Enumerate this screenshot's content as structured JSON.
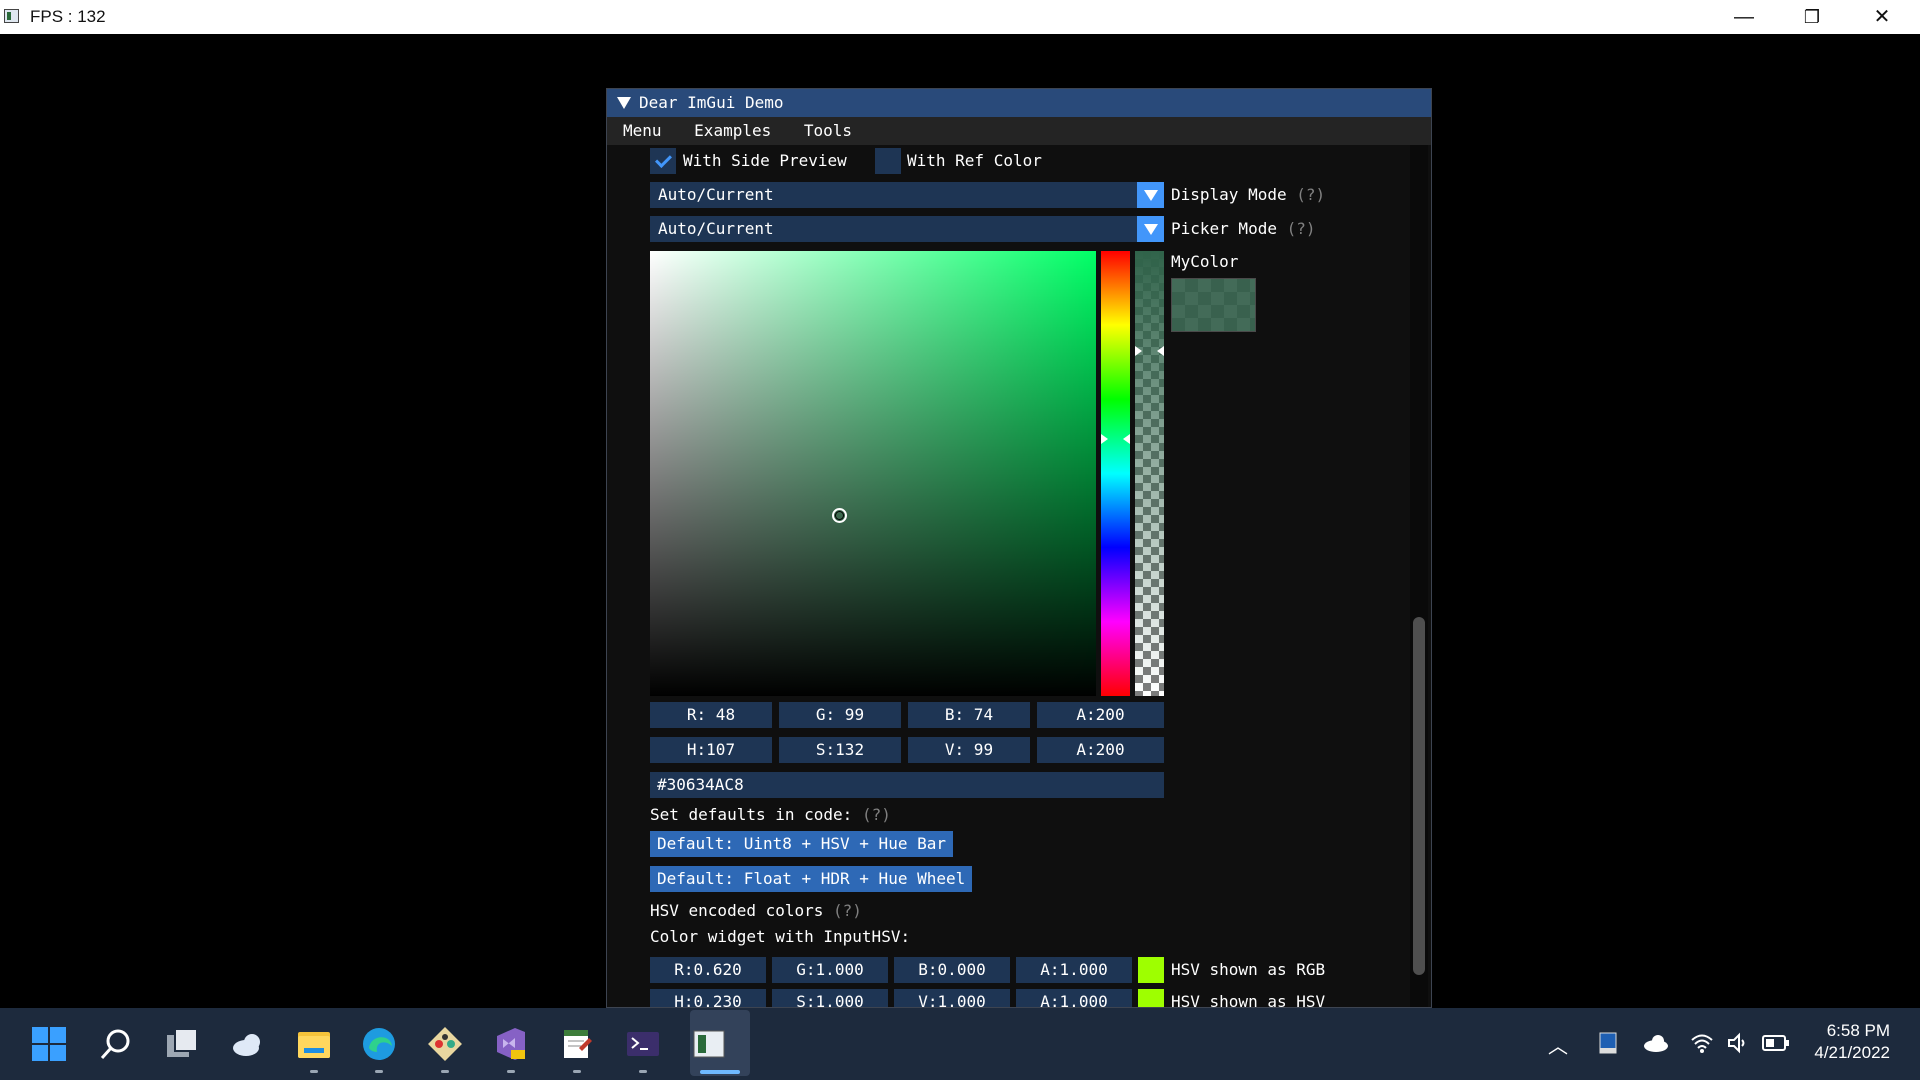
{
  "window": {
    "title": "FPS : 132",
    "controls": {
      "minimize": "—",
      "restore": "❐",
      "close": "✕"
    }
  },
  "imgui": {
    "title": "Dear ImGui Demo",
    "menu": [
      "Menu",
      "Examples",
      "Tools"
    ],
    "with_side_preview": {
      "label": "With Side Preview",
      "checked": true
    },
    "with_ref_color": {
      "label": "With Ref Color",
      "checked": false
    },
    "display_mode": {
      "value": "Auto/Current",
      "label": "Display Mode",
      "help": "(?)"
    },
    "picker_mode": {
      "value": "Auto/Current",
      "label": "Picker Mode",
      "help": "(?)"
    },
    "preview_label": "MyColor",
    "color": {
      "rgb_hex": "#30634A",
      "alpha": 200
    },
    "rgba_fields": [
      "R: 48",
      "G: 99",
      "B: 74",
      "A:200"
    ],
    "hsva_fields": [
      "H:107",
      "S:132",
      "V: 99",
      "A:200"
    ],
    "hex_value": "#30634AC8",
    "set_defaults_label": "Set defaults in code:",
    "set_defaults_help": "(?)",
    "default_buttons": [
      "Default: Uint8 + HSV + Hue Bar",
      "Default: Float + HDR + Hue Wheel"
    ],
    "hsv_encoded_label": "HSV encoded colors",
    "hsv_encoded_help": "(?)",
    "input_hsv_label": "Color widget with InputHSV:",
    "hsv_rgb_row": {
      "fields": [
        "R:0.620",
        "G:1.000",
        "B:0.000",
        "A:1.000"
      ],
      "label": "HSV shown as RGB"
    },
    "hsv_hsv_row": {
      "fields": [
        "H:0.230",
        "S:1.000",
        "V:1.000",
        "A:1.000"
      ],
      "label": "HSV shown as HSV"
    }
  },
  "taskbar": {
    "apps": [
      "windows-start-icon",
      "search-icon",
      "task-view-icon",
      "widgets-icon",
      "file-explorer-icon",
      "edge-icon",
      "git-icon",
      "visual-studio-preview-icon",
      "notepad-icon",
      "terminal-icon",
      "imgui-app-icon"
    ],
    "time": "6:58 PM",
    "date": "4/21/2022"
  },
  "colors": {
    "imgui_title": "#294a7a",
    "imgui_frame": "#1e3554",
    "imgui_button": "#2e69b6",
    "accent": "#4296fa",
    "taskbar": "#1d2a3d"
  }
}
